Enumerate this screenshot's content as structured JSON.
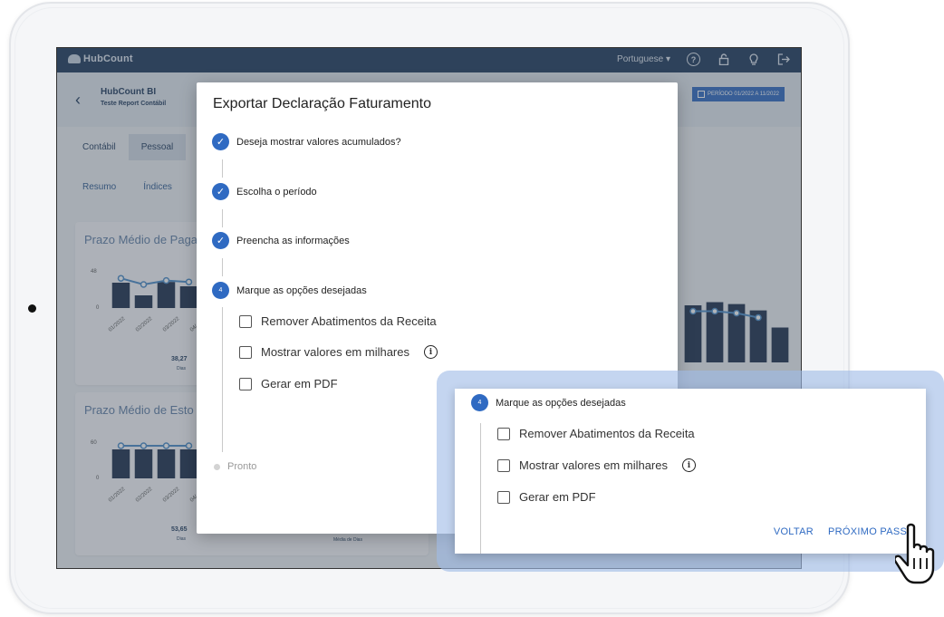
{
  "app": {
    "logo_text": "HubCount",
    "language": "Portuguese",
    "top_icons": [
      "help-icon",
      "lock-icon",
      "lightbulb-icon",
      "logout-icon"
    ]
  },
  "header": {
    "company_title": "HubCount BI",
    "company_subtitle": "Teste Report Contábil",
    "period_label": "PERÍODO 01/2022 A 11/2022"
  },
  "tabs": [
    {
      "label": "Contábil"
    },
    {
      "label": "Pessoal"
    }
  ],
  "subtabs": [
    {
      "label": "Resumo"
    },
    {
      "label": "Índices"
    }
  ],
  "cards": [
    {
      "title": "Prazo Médio de Paga",
      "y_max": "48",
      "y_min": "0",
      "x_ticks": [
        "01/2022",
        "02/2022",
        "03/2022",
        "04/"
      ],
      "kpi_value": "38,27",
      "kpi_label": "Dias",
      "bars": [
        0.7,
        0.35,
        0.72,
        0.6
      ],
      "line": [
        0.72,
        0.55,
        0.66,
        0.62
      ]
    },
    {
      "title": "Prazo Médio de Esto",
      "y_max": "60",
      "y_min": "0",
      "x_ticks": [
        "01/2022",
        "02/2022",
        "03/2022",
        "04/"
      ],
      "kpi_value": "53,65",
      "kpi_label": "Dias",
      "kpi_center_label": "Média de Dias",
      "bars": [
        0.8,
        0.8,
        0.8,
        0.8
      ],
      "line": [
        0.8,
        0.8,
        0.8,
        0.8
      ]
    }
  ],
  "right_chart": {
    "bars": [
      0.9,
      0.95,
      0.92,
      0.82,
      0.55
    ],
    "line": [
      0.75,
      0.75,
      0.72,
      0.65
    ]
  },
  "modal": {
    "title": "Exportar Declaração Faturamento",
    "steps": [
      {
        "label": "Deseja mostrar valores acumulados?",
        "state": "done"
      },
      {
        "label": "Escolha o período",
        "state": "done"
      },
      {
        "label": "Preencha as informações",
        "state": "done"
      },
      {
        "label": "Marque as opções desejadas",
        "state": "active",
        "number": "4"
      }
    ],
    "options": [
      {
        "label": "Remover Abatimentos da Receita",
        "checked": false
      },
      {
        "label": "Mostrar valores em milhares",
        "checked": false,
        "info_icon": "info-icon"
      },
      {
        "label": "Gerar em PDF",
        "checked": false
      }
    ],
    "final_step": "Pronto"
  },
  "callout": {
    "step_number": "4",
    "step_label": "Marque as opções desejadas",
    "options": [
      {
        "label": "Remover Abatimentos da Receita"
      },
      {
        "label": "Mostrar valores em milhares"
      },
      {
        "label": "Gerar em PDF"
      }
    ],
    "back_label": "VOLTAR",
    "next_label": "PRÓXIMO PASSO"
  },
  "colors": {
    "accent": "#2f6ac2",
    "topbar": "#1e3a5c",
    "bar": "#1c2f4c",
    "line": "#4a8cc9"
  }
}
